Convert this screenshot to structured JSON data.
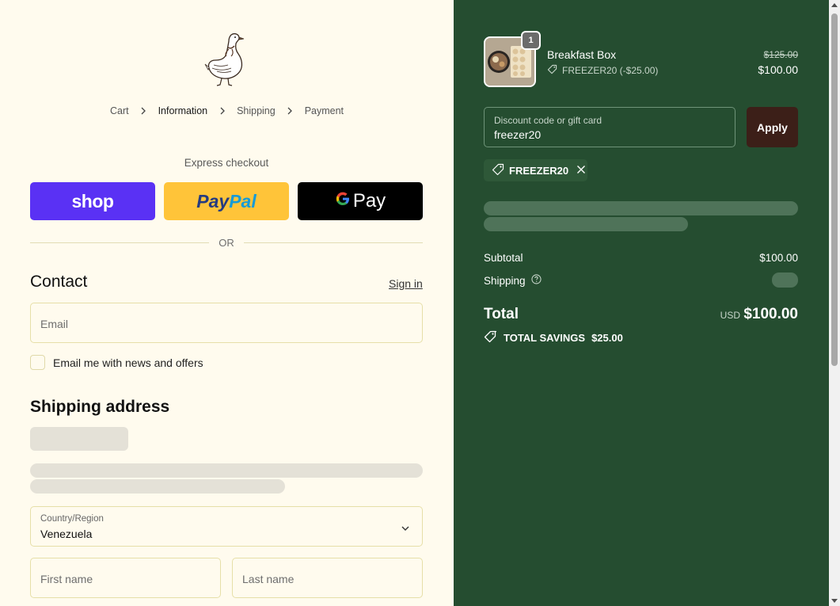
{
  "breadcrumb": {
    "cart": "Cart",
    "information": "Information",
    "shipping": "Shipping",
    "payment": "Payment"
  },
  "express": {
    "title": "Express checkout",
    "shop_label": "shop",
    "paypal_part1": "Pay",
    "paypal_part2": "Pal",
    "gpay_g": "G",
    "gpay_label": "Pay",
    "or": "OR"
  },
  "contact": {
    "title": "Contact",
    "sign_in": "Sign in",
    "email_placeholder": "Email",
    "news_label": "Email me with news and offers",
    "news_checked": false
  },
  "shipping_address": {
    "title": "Shipping address",
    "country_label": "Country/Region",
    "country_value": "Venezuela",
    "first_name_placeholder": "First name",
    "last_name_placeholder": "Last name"
  },
  "order": {
    "product": {
      "quantity": "1",
      "name": "Breakfast Box",
      "discount": "FREEZER20 (-$25.00)",
      "original_price": "$125.00",
      "price": "$100.00"
    },
    "discount_field": {
      "label": "Discount code or gift card",
      "value": "freezer20"
    },
    "apply_label": "Apply",
    "applied_code": "FREEZER20",
    "subtotal_label": "Subtotal",
    "subtotal_value": "$100.00",
    "shipping_label": "Shipping",
    "total_label": "Total",
    "currency": "USD",
    "total_value": "$100.00",
    "savings_label": "TOTAL SAVINGS",
    "savings_value": "$25.00"
  },
  "colors": {
    "left_bg": "#fffbee",
    "right_bg": "#254d30",
    "shop_purple": "#5a31f4",
    "paypal_yellow": "#ffc439",
    "apply_brown": "#3c1f18"
  },
  "icons": [
    "goose-logo",
    "chevron-right-icon",
    "chevron-down-icon",
    "tag-icon",
    "close-icon",
    "help-circle-icon",
    "savings-tag-icon"
  ]
}
